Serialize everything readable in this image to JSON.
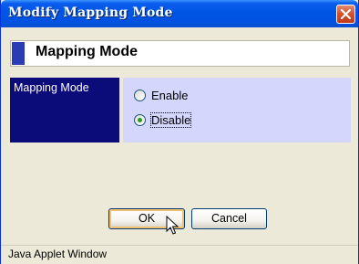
{
  "window": {
    "title": "Modify Mapping Mode",
    "status_text": "Java Applet Window"
  },
  "section": {
    "heading": "Mapping Mode",
    "field_label": "Mapping Mode"
  },
  "options": [
    {
      "label": "Enable",
      "selected": false
    },
    {
      "label": "Disable",
      "selected": true
    }
  ],
  "buttons": {
    "ok": "OK",
    "cancel": "Cancel"
  },
  "icons": {
    "close": "close-icon",
    "cursor": "mouse-pointer-icon"
  },
  "colors": {
    "titlebar": "#0054e3",
    "label_panel": "#0b0b7a",
    "options_panel": "#d5d6fb",
    "header_accent": "#2b3bb5"
  }
}
